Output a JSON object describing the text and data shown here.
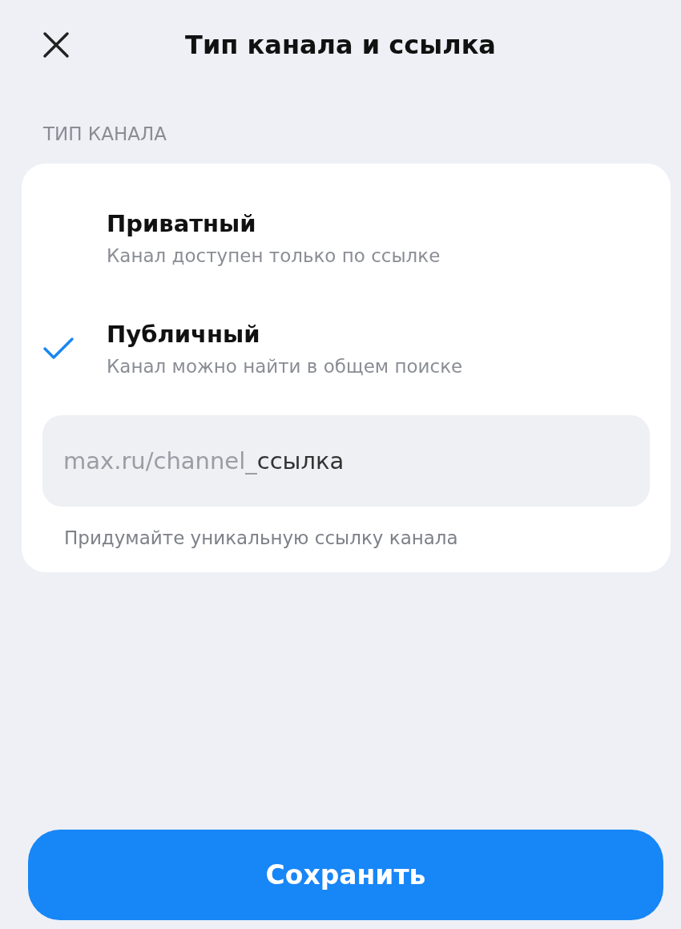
{
  "header": {
    "title": "Тип канала и ссылка"
  },
  "section_label": "ТИП КАНАЛА",
  "options": [
    {
      "title": "Приватный",
      "subtitle": "Канал доступен только по ссылке",
      "selected": false
    },
    {
      "title": "Публичный",
      "subtitle": "Канал можно найти в общем поиске",
      "selected": true
    }
  ],
  "link_field": {
    "prefix": "max.ru/channel_",
    "value": "ссылка"
  },
  "hint": "Придумайте уникальную ссылку канала",
  "save_button": "Сохранить"
}
